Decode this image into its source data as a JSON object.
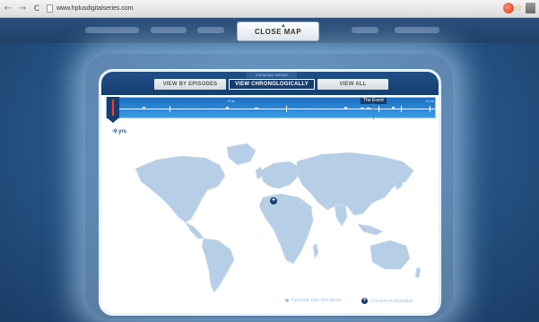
{
  "browser": {
    "back": "←",
    "forward": "→",
    "reload": "C",
    "url": "www.hplusdigitalseries.com",
    "bookmark": "☆"
  },
  "close_map": {
    "label": "CLOSE MAP"
  },
  "viewing_mode": {
    "label": "VIEWING MODE",
    "tabs": [
      {
        "label": "VIEW BY EPISODES",
        "active": false
      },
      {
        "label": "VIEW CHRONOLOGICALLY",
        "active": true
      },
      {
        "label": "VIEW ALL",
        "active": false
      }
    ]
  },
  "timeline": {
    "start_label": "-9 yrs",
    "mid_label": "0 hs",
    "end_label": "+6 hs",
    "event_label": "The Event"
  },
  "map": {
    "pin": "+"
  },
  "legend": {
    "not_aired": "Episode Has Not Aired",
    "available": "Content is Available",
    "available_symbol": "+"
  },
  "colors": {
    "panel_header": "#173e6e",
    "timeline": "#2a83d4",
    "event_line": "#ff4a3a",
    "continents": "#b7cfe6"
  }
}
